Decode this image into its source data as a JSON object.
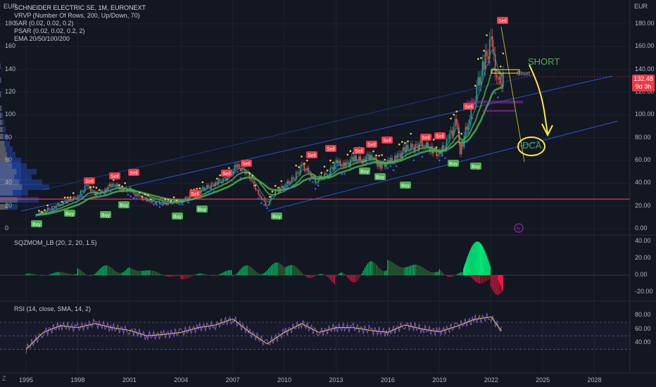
{
  "header": {
    "title": "SCHNEIDER ELECTRIC SE, 1M, EURONEXT",
    "indicators": [
      "VRVP (Number Of Rows, 200, Up/Down, 70)",
      "SAR (0.02, 0.02, 0.2)",
      "PSAR (0.02, 0.02, 0.2, 2)",
      "EMA 20/50/100/200"
    ]
  },
  "price_axis": {
    "currency_left": "EUR",
    "currency_right": "EUR",
    "left_ticks": [
      "180",
      "160",
      "140",
      "120",
      "100",
      "80",
      "60",
      "40",
      "20",
      "0"
    ],
    "right_ticks": [
      "180.00",
      "160.00",
      "140.00",
      "120.00",
      "100.00",
      "80.00",
      "60.00",
      "40.00",
      "20.00",
      "0.00"
    ],
    "last_price": "132.48",
    "countdown": "9d 3h"
  },
  "time_axis": [
    "1995",
    "1998",
    "2001",
    "2004",
    "2007",
    "2010",
    "2013",
    "2016",
    "2019",
    "2022",
    "2025",
    "2028"
  ],
  "panes": {
    "sqzmom": {
      "label": "SQZMOM_LB (20, 2, 20, 1.5)",
      "ticks": [
        "40.00",
        "20.00",
        "0.00",
        "-20.00"
      ]
    },
    "rsi": {
      "label": "RSI (14, close, SMA, 14, 2)",
      "ticks": [
        "80.00",
        "60.00",
        "40.00"
      ]
    }
  },
  "annotations": {
    "short": "SHORT",
    "dca": "DCA",
    "short_small": "Short"
  },
  "signals": {
    "sell": "Sell",
    "buy": "Buy"
  },
  "colors": {
    "background": "#131722",
    "up": "#26a69a",
    "down": "#ef5350",
    "sell": "#f23645",
    "buy": "#4caf50",
    "rsi": "#7e57c2",
    "ema": "#4caf50",
    "sar": "#f7c948",
    "psar": "#2962ff",
    "annotation": "#ffeb3b",
    "support": "#f23645"
  },
  "chart_data": [
    {
      "type": "candlestick",
      "title": "SCHNEIDER ELECTRIC SE, 1M, EURONEXT",
      "ylabel": "EUR",
      "ylim": [
        0,
        190
      ],
      "x": [
        1995.5,
        1996,
        1997,
        1998,
        1998.5,
        1999,
        1999.5,
        2000,
        2000.5,
        2001,
        2001.5,
        2002,
        2003,
        2004,
        2005,
        2006,
        2006.7,
        2007.2,
        2007.8,
        2008.5,
        2009,
        2009.3,
        2010,
        2010.6,
        2011,
        2011.4,
        2011.8,
        2012.5,
        2013,
        2013.5,
        2014,
        2014.5,
        2015,
        2015.5,
        2016,
        2016.5,
        2017,
        2017.6,
        2018,
        2018.5,
        2019,
        2019.5,
        2020,
        2020.2,
        2020.6,
        2021,
        2021.5,
        2022,
        2022.4,
        2022.7
      ],
      "close": [
        12,
        15,
        22,
        28,
        38,
        30,
        33,
        40,
        35,
        34,
        28,
        25,
        22,
        24,
        33,
        40,
        45,
        55,
        50,
        30,
        20,
        30,
        38,
        45,
        55,
        50,
        42,
        48,
        58,
        55,
        62,
        60,
        65,
        55,
        58,
        62,
        70,
        72,
        75,
        70,
        65,
        78,
        95,
        68,
        90,
        115,
        140,
        165,
        125,
        132.48
      ]
    },
    {
      "type": "bar",
      "title": "SQZMOM_LB (20, 2, 20, 1.5)",
      "categories": [
        "1995",
        "1998",
        "2001",
        "2004",
        "2007",
        "2010",
        "2013",
        "2016",
        "2019",
        "2022",
        "2022.7"
      ],
      "values": [
        0,
        3,
        9,
        -3,
        4,
        10,
        -8,
        15,
        5,
        -8,
        -18
      ],
      "ylim": [
        -25,
        45
      ]
    },
    {
      "type": "line",
      "title": "RSI (14, close, SMA, 14, 2)",
      "x": [
        1995,
        1996,
        1997,
        1998,
        1999,
        2000,
        2001,
        2002,
        2003,
        2004,
        2005,
        2006,
        2007,
        2008,
        2009,
        2010,
        2011,
        2012,
        2013,
        2014,
        2015,
        2016,
        2017,
        2018,
        2019,
        2020,
        2021,
        2022,
        2022.7
      ],
      "series": [
        {
          "values": [
            30,
            55,
            65,
            62,
            68,
            62,
            58,
            50,
            52,
            55,
            62,
            66,
            75,
            55,
            38,
            55,
            68,
            55,
            62,
            62,
            58,
            55,
            66,
            60,
            56,
            64,
            74,
            78,
            54
          ]
        }
      ],
      "ylim": [
        30,
        90
      ]
    }
  ]
}
